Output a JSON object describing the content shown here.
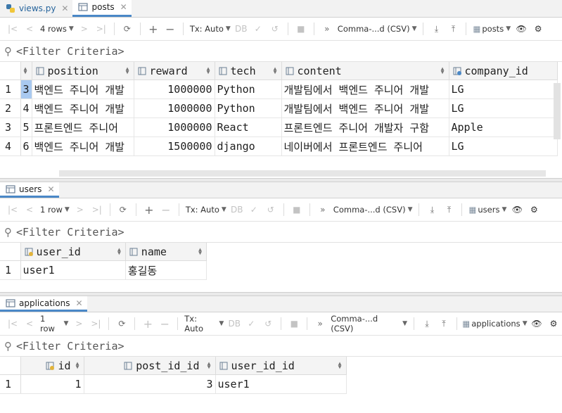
{
  "posts": {
    "tabs": [
      {
        "label": "views.py",
        "icon": "python-file-icon"
      },
      {
        "label": "posts",
        "icon": "table-icon"
      }
    ],
    "toolbar": {
      "rows": "4 rows",
      "tx": "Tx: Auto",
      "format": "Comma-...d (CSV)",
      "table": "posts"
    },
    "filter": "<Filter Criteria>",
    "columns": [
      "position",
      "reward",
      "tech",
      "content",
      "company_id"
    ],
    "rows": [
      {
        "n": "1",
        "id": "3",
        "position": "백엔드 주니어 개발",
        "reward": "1000000",
        "tech": "Python",
        "content": "개발팀에서 백엔드 주니어 개발",
        "company": "LG"
      },
      {
        "n": "2",
        "id": "4",
        "position": "백엔드 주니어 개발",
        "reward": "1000000",
        "tech": "Python",
        "content": "개발팀에서 백엔드 주니어 개발",
        "company": "LG"
      },
      {
        "n": "3",
        "id": "5",
        "position": "프론트엔드 주니어",
        "reward": "1000000",
        "tech": "React",
        "content": "프론트엔드 주니어 개발자 구함",
        "company": "Apple"
      },
      {
        "n": "4",
        "id": "6",
        "position": "백엔드 주니어 개발",
        "reward": "1500000",
        "tech": "django",
        "content": "네이버에서 프론트엔드 주니어",
        "company": "LG"
      }
    ]
  },
  "users": {
    "tab": "users",
    "toolbar": {
      "rows": "1 row",
      "tx": "Tx: Auto",
      "format": "Comma-...d (CSV)",
      "table": "users"
    },
    "filter": "<Filter Criteria>",
    "columns": [
      "user_id",
      "name"
    ],
    "rows": [
      {
        "n": "1",
        "user_id": "user1",
        "name": "홍길동"
      }
    ]
  },
  "applications": {
    "tab": "applications",
    "toolbar": {
      "rows": "1 row",
      "tx": "Tx: Auto",
      "format": "Comma-...d (CSV)",
      "table": "applications"
    },
    "filter": "<Filter Criteria>",
    "columns": [
      "id",
      "post_id_id",
      "user_id_id"
    ],
    "rows": [
      {
        "n": "1",
        "id": "1",
        "post_id_id": "3",
        "user_id_id": "user1"
      }
    ]
  }
}
